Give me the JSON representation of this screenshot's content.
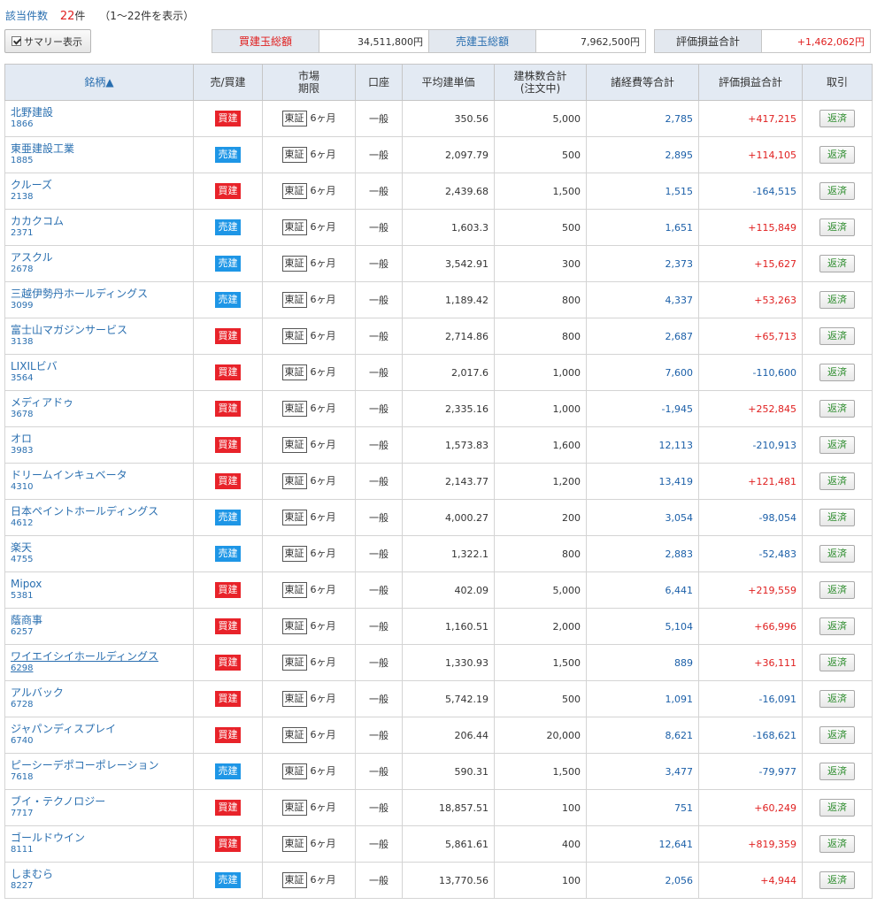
{
  "header": {
    "count_label": "該当件数",
    "count_value": "22",
    "count_unit": "件",
    "range_text": "（1～22件を表示）"
  },
  "summary_toggle": {
    "label": "サマリー表示",
    "checked": true
  },
  "summary": {
    "buy_label": "買建玉総額",
    "buy_value": "34,511,800円",
    "sell_label": "売建玉総額",
    "sell_value": "7,962,500円",
    "eval_label": "評価損益合計",
    "eval_value": "+1,462,062円"
  },
  "columns": {
    "symbol": "銘柄▲",
    "side": "売/買建",
    "market_l1": "市場",
    "market_l2": "期限",
    "account": "口座",
    "avg_price": "平均建単価",
    "qty_l1": "建株数合計",
    "qty_l2": "(注文中)",
    "fees": "諸経費等合計",
    "pl": "評価損益合計",
    "trade": "取引"
  },
  "colors": {
    "buy": "#e8232a",
    "sell": "#1e96e6",
    "link": "#2a6fb0",
    "profit": "#e02020",
    "loss": "#1b5fa8"
  },
  "rows": [
    {
      "name": "北野建設",
      "code": "1866",
      "side": "買建",
      "side_type": "buy",
      "market": "東証",
      "term": "6ヶ月",
      "account": "一般",
      "avg_price": "350.56",
      "qty": "5,000",
      "fees": "2,785",
      "pl": "+417,215",
      "pl_type": "profit",
      "action": "返済"
    },
    {
      "name": "東亜建設工業",
      "code": "1885",
      "side": "売建",
      "side_type": "sell",
      "market": "東証",
      "term": "6ヶ月",
      "account": "一般",
      "avg_price": "2,097.79",
      "qty": "500",
      "fees": "2,895",
      "pl": "+114,105",
      "pl_type": "profit",
      "action": "返済"
    },
    {
      "name": "クルーズ",
      "code": "2138",
      "side": "買建",
      "side_type": "buy",
      "market": "東証",
      "term": "6ヶ月",
      "account": "一般",
      "avg_price": "2,439.68",
      "qty": "1,500",
      "fees": "1,515",
      "pl": "-164,515",
      "pl_type": "loss",
      "action": "返済"
    },
    {
      "name": "カカクコム",
      "code": "2371",
      "side": "売建",
      "side_type": "sell",
      "market": "東証",
      "term": "6ヶ月",
      "account": "一般",
      "avg_price": "1,603.3",
      "qty": "500",
      "fees": "1,651",
      "pl": "+115,849",
      "pl_type": "profit",
      "action": "返済"
    },
    {
      "name": "アスクル",
      "code": "2678",
      "side": "売建",
      "side_type": "sell",
      "market": "東証",
      "term": "6ヶ月",
      "account": "一般",
      "avg_price": "3,542.91",
      "qty": "300",
      "fees": "2,373",
      "pl": "+15,627",
      "pl_type": "profit",
      "action": "返済"
    },
    {
      "name": "三越伊勢丹ホールディングス",
      "code": "3099",
      "side": "売建",
      "side_type": "sell",
      "market": "東証",
      "term": "6ヶ月",
      "account": "一般",
      "avg_price": "1,189.42",
      "qty": "800",
      "fees": "4,337",
      "pl": "+53,263",
      "pl_type": "profit",
      "action": "返済"
    },
    {
      "name": "富士山マガジンサービス",
      "code": "3138",
      "side": "買建",
      "side_type": "buy",
      "market": "東証",
      "term": "6ヶ月",
      "account": "一般",
      "avg_price": "2,714.86",
      "qty": "800",
      "fees": "2,687",
      "pl": "+65,713",
      "pl_type": "profit",
      "action": "返済"
    },
    {
      "name": "LIXILビバ",
      "code": "3564",
      "side": "買建",
      "side_type": "buy",
      "market": "東証",
      "term": "6ヶ月",
      "account": "一般",
      "avg_price": "2,017.6",
      "qty": "1,000",
      "fees": "7,600",
      "pl": "-110,600",
      "pl_type": "loss",
      "action": "返済"
    },
    {
      "name": "メディアドゥ",
      "code": "3678",
      "side": "買建",
      "side_type": "buy",
      "market": "東証",
      "term": "6ヶ月",
      "account": "一般",
      "avg_price": "2,335.16",
      "qty": "1,000",
      "fees": "-1,945",
      "pl": "+252,845",
      "pl_type": "profit",
      "action": "返済"
    },
    {
      "name": "オロ",
      "code": "3983",
      "side": "買建",
      "side_type": "buy",
      "market": "東証",
      "term": "6ヶ月",
      "account": "一般",
      "avg_price": "1,573.83",
      "qty": "1,600",
      "fees": "12,113",
      "pl": "-210,913",
      "pl_type": "loss",
      "action": "返済"
    },
    {
      "name": "ドリームインキュベータ",
      "code": "4310",
      "side": "買建",
      "side_type": "buy",
      "market": "東証",
      "term": "6ヶ月",
      "account": "一般",
      "avg_price": "2,143.77",
      "qty": "1,200",
      "fees": "13,419",
      "pl": "+121,481",
      "pl_type": "profit",
      "action": "返済"
    },
    {
      "name": "日本ペイントホールディングス",
      "code": "4612",
      "side": "売建",
      "side_type": "sell",
      "market": "東証",
      "term": "6ヶ月",
      "account": "一般",
      "avg_price": "4,000.27",
      "qty": "200",
      "fees": "3,054",
      "pl": "-98,054",
      "pl_type": "loss",
      "action": "返済"
    },
    {
      "name": "楽天",
      "code": "4755",
      "side": "売建",
      "side_type": "sell",
      "market": "東証",
      "term": "6ヶ月",
      "account": "一般",
      "avg_price": "1,322.1",
      "qty": "800",
      "fees": "2,883",
      "pl": "-52,483",
      "pl_type": "loss",
      "action": "返済"
    },
    {
      "name": "Mipox",
      "code": "5381",
      "side": "買建",
      "side_type": "buy",
      "market": "東証",
      "term": "6ヶ月",
      "account": "一般",
      "avg_price": "402.09",
      "qty": "5,000",
      "fees": "6,441",
      "pl": "+219,559",
      "pl_type": "profit",
      "action": "返済"
    },
    {
      "name": "蔭商事",
      "code": "6257",
      "side": "買建",
      "side_type": "buy",
      "market": "東証",
      "term": "6ヶ月",
      "account": "一般",
      "avg_price": "1,160.51",
      "qty": "2,000",
      "fees": "5,104",
      "pl": "+66,996",
      "pl_type": "profit",
      "action": "返済"
    },
    {
      "name": "ワイエイシイホールディングス",
      "code": "6298",
      "side": "買建",
      "side_type": "buy",
      "market": "東証",
      "term": "6ヶ月",
      "account": "一般",
      "avg_price": "1,330.93",
      "qty": "1,500",
      "fees": "889",
      "pl": "+36,111",
      "pl_type": "profit",
      "action": "返済",
      "hover": true
    },
    {
      "name": "アルバック",
      "code": "6728",
      "side": "買建",
      "side_type": "buy",
      "market": "東証",
      "term": "6ヶ月",
      "account": "一般",
      "avg_price": "5,742.19",
      "qty": "500",
      "fees": "1,091",
      "pl": "-16,091",
      "pl_type": "loss",
      "action": "返済"
    },
    {
      "name": "ジャパンディスプレイ",
      "code": "6740",
      "side": "買建",
      "side_type": "buy",
      "market": "東証",
      "term": "6ヶ月",
      "account": "一般",
      "avg_price": "206.44",
      "qty": "20,000",
      "fees": "8,621",
      "pl": "-168,621",
      "pl_type": "loss",
      "action": "返済"
    },
    {
      "name": "ピーシーデポコーポレーション",
      "code": "7618",
      "side": "売建",
      "side_type": "sell",
      "market": "東証",
      "term": "6ヶ月",
      "account": "一般",
      "avg_price": "590.31",
      "qty": "1,500",
      "fees": "3,477",
      "pl": "-79,977",
      "pl_type": "loss",
      "action": "返済"
    },
    {
      "name": "ブイ・テクノロジー",
      "code": "7717",
      "side": "買建",
      "side_type": "buy",
      "market": "東証",
      "term": "6ヶ月",
      "account": "一般",
      "avg_price": "18,857.51",
      "qty": "100",
      "fees": "751",
      "pl": "+60,249",
      "pl_type": "profit",
      "action": "返済"
    },
    {
      "name": "ゴールドウイン",
      "code": "8111",
      "side": "買建",
      "side_type": "buy",
      "market": "東証",
      "term": "6ヶ月",
      "account": "一般",
      "avg_price": "5,861.61",
      "qty": "400",
      "fees": "12,641",
      "pl": "+819,359",
      "pl_type": "profit",
      "action": "返済"
    },
    {
      "name": "しまむら",
      "code": "8227",
      "side": "売建",
      "side_type": "sell",
      "market": "東証",
      "term": "6ヶ月",
      "account": "一般",
      "avg_price": "13,770.56",
      "qty": "100",
      "fees": "2,056",
      "pl": "+4,944",
      "pl_type": "profit",
      "action": "返済"
    }
  ]
}
